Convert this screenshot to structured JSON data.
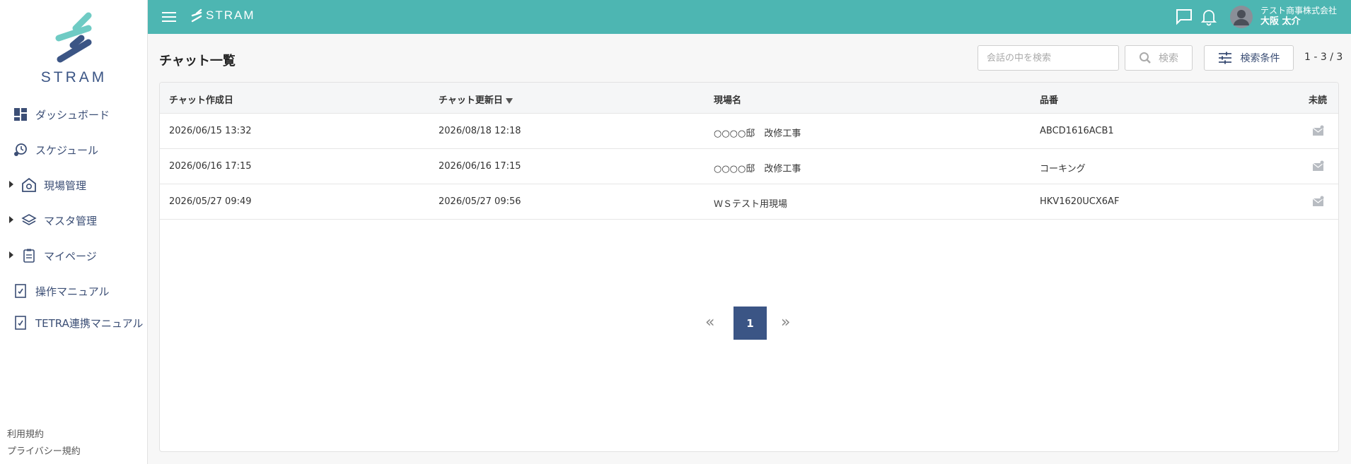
{
  "sidebar": {
    "logo_text": "STRAM",
    "items": [
      {
        "label": "ダッシュボード",
        "icon": "dashboard-icon"
      },
      {
        "label": "スケジュール",
        "icon": "schedule-icon"
      },
      {
        "label": "現場管理",
        "icon": "site-management-icon"
      },
      {
        "label": "マスタ管理",
        "icon": "layers-icon"
      },
      {
        "label": "マイページ",
        "icon": "clipboard-icon"
      },
      {
        "label": "操作マニュアル",
        "icon": "manual-icon"
      },
      {
        "label": "TETRA連携マニュアル",
        "icon": "manual-icon"
      }
    ],
    "footer": {
      "terms": "利用規約",
      "privacy": "プライバシー規約"
    }
  },
  "topbar": {
    "logo_text": "STRAM",
    "company": "テスト商事株式会社",
    "user_name": "大阪 太介",
    "icons": [
      "menu-icon",
      "chat-icon",
      "bell-icon",
      "user-avatar-icon"
    ]
  },
  "main": {
    "title": "チャット一覧",
    "search_placeholder": "会話の中を検索",
    "search_button": "検索",
    "condition_button": "検索条件",
    "count": "1 - 3 / 3",
    "columns": [
      "チャット作成日",
      "チャット更新日",
      "現場名",
      "品番",
      "未読"
    ],
    "rows": [
      {
        "created": "2026/06/15 13:32",
        "updated": "2026/08/18 12:18",
        "site": "○○○○邸　改修工事",
        "part": "ABCD1616ACB1"
      },
      {
        "created": "2026/06/16 17:15",
        "updated": "2026/06/16 17:15",
        "site": "○○○○邸　改修工事",
        "part": "コーキング"
      },
      {
        "created": "2026/05/27 09:49",
        "updated": "2026/05/27 09:56",
        "site": "ＷＳテスト用現場",
        "part": "HKV1620UCX6AF"
      }
    ],
    "pagination": {
      "prev": "«",
      "current": "1",
      "next": "»"
    }
  },
  "colors": {
    "accent": "#4db6b2",
    "navy": "#3b5585",
    "mint": "#6fcbc4"
  }
}
